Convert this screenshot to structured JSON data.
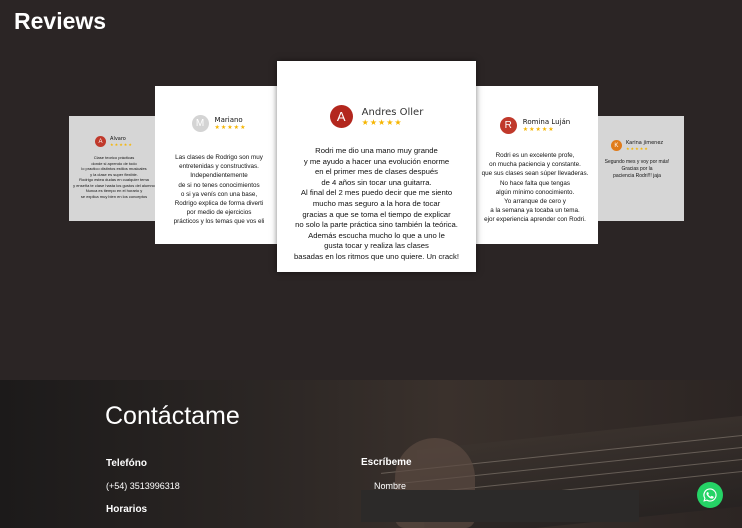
{
  "reviews": {
    "title": "Reviews",
    "cards": [
      {
        "name": "Alvaro",
        "initial": "A",
        "stars": "★★★★★",
        "text": "Clase teorico prácticas\ndonde si aprendo de todo\nlo practico distintos estilos musicales\ny la clase es super flexible.\nRodrigo estea dudas en cualquier tema\ny enseña te clase hasta los gustos del alumno\nNunca es tiempo en el horario y\nse explica muy bien en los conceptos",
        "color": "#c0392b"
      },
      {
        "name": "Mariano",
        "initial": "M",
        "stars": "★★★★★",
        "text": "Las clases de Rodrigo son muy\nentretenidas y constructivas.\nIndependientemente\nde si no tenes conocimientos\no si ya venís con una base,\nRodrigo explica de forma diverti\npor medio de ejercicios\nprácticos y los temas que vos eli",
        "color": "#cfcfcf"
      },
      {
        "name": "Andres Oller",
        "initial": "A",
        "stars": "★★★★★",
        "text": "Rodri me dio una mano muy grande\ny me ayudo a hacer una evolución enorme\nen el primer mes de clases después\nde 4 años sin tocar una guitarra.\nAl final del 2 mes puedo decir que me  siento\nmucho mas seguro a la hora de tocar\ngracias a que se toma el tiempo de explicar\nno solo la parte práctica sino también la teórica.\nAdemás escucha mucho lo que a uno le\ngusta tocar y realiza las clases\nbasadas en los ritmos que uno quiere. Un crack!",
        "color": "#b3271e"
      },
      {
        "name": "Romina Luján",
        "initial": "R",
        "stars": "★★★★★",
        "text": "Rodri es un excelente profe,\non mucha paciencia y constante.\nque sus clases sean súper llevaderas.\nNo hace falta que tengas\nalgún mínimo conocimiento.\nYo arranque de cero y\na la semana ya tocaba un tema.\nejor experiencia aprender con Rodri.",
        "color": "#c0392b"
      },
      {
        "name": "Karina jimenez",
        "initial": "K",
        "stars": "★★★★★",
        "text": "Segundo mes y voy por más!\nGracias por la\npaciencia Rodri!!! jaja",
        "color": "#e07b1a"
      }
    ]
  },
  "contact": {
    "title": "Contáctame",
    "phone_label": "Telefóno",
    "phone": "(+54) 3513996318",
    "hours_label": "Horarios",
    "write_label": "Escríbeme",
    "name_placeholder": "Nombre"
  },
  "colors": {
    "background": "#2a2424",
    "whatsapp": "#25d366",
    "star": "#f6b500"
  },
  "icons": {
    "whatsapp": "whatsapp-icon"
  }
}
